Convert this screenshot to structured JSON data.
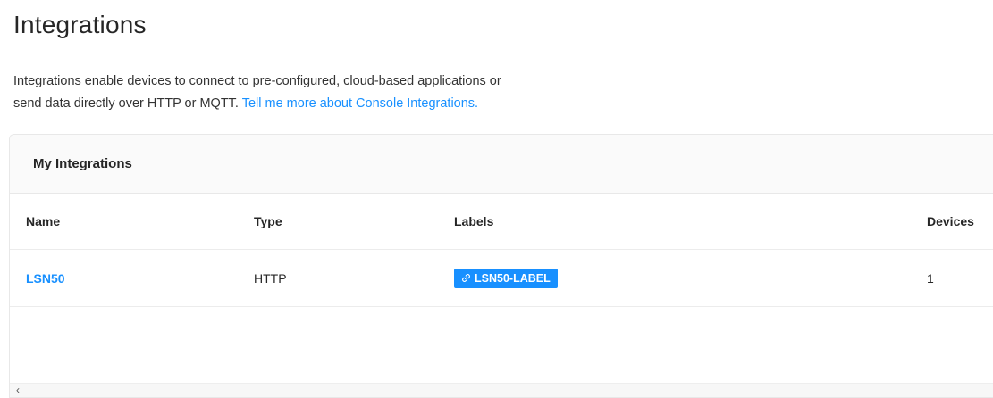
{
  "page": {
    "title": "Integrations"
  },
  "intro": {
    "text_line1": "Integrations enable devices to connect to pre-configured, cloud-based applications or",
    "text_line2": "send data directly over HTTP or MQTT. ",
    "link_text": "Tell me more about Console Integrations."
  },
  "card": {
    "title": "My Integrations",
    "columns": {
      "name": "Name",
      "type": "Type",
      "labels": "Labels",
      "devices": "Devices"
    },
    "rows": [
      {
        "name": "LSN50",
        "type": "HTTP",
        "label": "LSN50-LABEL",
        "devices": "1"
      }
    ]
  },
  "scrollbar": {
    "left_arrow": "‹"
  },
  "colors": {
    "accent": "#1890ff",
    "text": "#262626",
    "header_bg": "#fafafa"
  },
  "icons": {
    "label_tag_icon": "link-icon"
  }
}
